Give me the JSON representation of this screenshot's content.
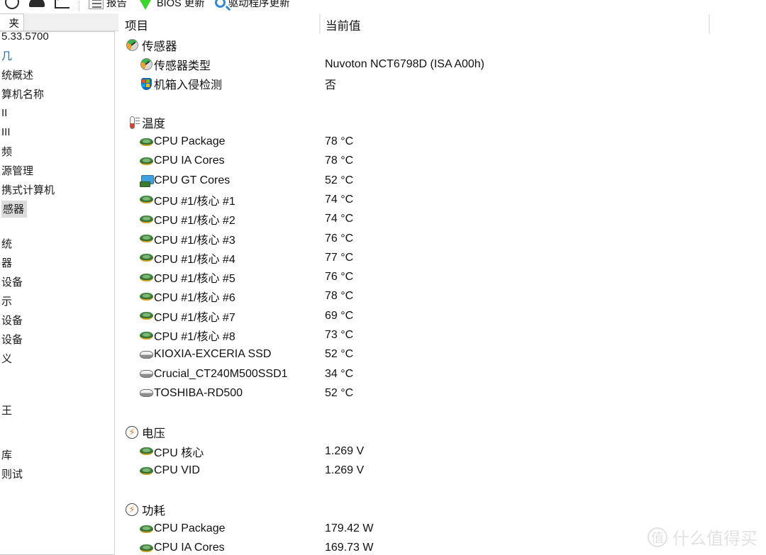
{
  "toolbar": {
    "items": [
      {
        "icon": "refresh-icon",
        "label": ""
      },
      {
        "icon": "cpu-icon",
        "label": ""
      },
      {
        "icon": "chart-icon",
        "label": ""
      },
      {
        "icon": "report-icon",
        "label": "报告"
      },
      {
        "icon": "green-arrow-icon",
        "label": "BIOS 更新"
      },
      {
        "icon": "magnifier-icon",
        "label": "驱动程序更新"
      }
    ]
  },
  "sidebar": {
    "tab_label": "夹",
    "items": [
      {
        "label": "5.33.5700",
        "state": "normal"
      },
      {
        "label": "几",
        "state": "link"
      },
      {
        "label": "统概述",
        "state": "normal"
      },
      {
        "label": "算机名称",
        "state": "normal"
      },
      {
        "label": "II",
        "state": "normal"
      },
      {
        "label": "III",
        "state": "normal"
      },
      {
        "label": "频",
        "state": "normal"
      },
      {
        "label": "源管理",
        "state": "normal"
      },
      {
        "label": "携式计算机",
        "state": "normal"
      },
      {
        "label": "感器",
        "state": "selected"
      },
      {
        "label": "统",
        "state": "normal"
      },
      {
        "label": "器",
        "state": "normal"
      },
      {
        "label": "设备",
        "state": "normal"
      },
      {
        "label": "示",
        "state": "normal"
      },
      {
        "label": "设备",
        "state": "normal"
      },
      {
        "label": "设备",
        "state": "normal"
      },
      {
        "label": "义",
        "state": "normal"
      },
      {
        "label": "王",
        "state": "normal"
      },
      {
        "label": "库",
        "state": "normal"
      },
      {
        "label": "则试",
        "state": "normal"
      }
    ]
  },
  "columns": {
    "item": "项目",
    "current_value": "当前值"
  },
  "sections": [
    {
      "title": "传感器",
      "icon": "gauge-icon",
      "rows": [
        {
          "icon": "gauge-icon",
          "label": "传感器类型",
          "value": "Nuvoton NCT6798D  (ISA A00h)"
        },
        {
          "icon": "shield-icon",
          "label": "机箱入侵检测",
          "value": "否"
        }
      ]
    },
    {
      "title": "温度",
      "icon": "thermometer-icon",
      "rows": [
        {
          "icon": "chip-icon",
          "label": "CPU Package",
          "value": "78 °C"
        },
        {
          "icon": "chip-icon",
          "label": "CPU IA Cores",
          "value": "78 °C"
        },
        {
          "icon": "gpu-icon",
          "label": "CPU GT Cores",
          "value": "52 °C"
        },
        {
          "icon": "chip-icon",
          "label": "CPU #1/核心 #1",
          "value": "74 °C"
        },
        {
          "icon": "chip-icon",
          "label": "CPU #1/核心 #2",
          "value": "74 °C"
        },
        {
          "icon": "chip-icon",
          "label": "CPU #1/核心 #3",
          "value": "76 °C"
        },
        {
          "icon": "chip-icon",
          "label": "CPU #1/核心 #4",
          "value": "77 °C"
        },
        {
          "icon": "chip-icon",
          "label": "CPU #1/核心 #5",
          "value": "76 °C"
        },
        {
          "icon": "chip-icon",
          "label": "CPU #1/核心 #6",
          "value": "78 °C"
        },
        {
          "icon": "chip-icon",
          "label": "CPU #1/核心 #7",
          "value": "69 °C"
        },
        {
          "icon": "chip-icon",
          "label": "CPU #1/核心 #8",
          "value": "73 °C"
        },
        {
          "icon": "disk-icon",
          "label": "KIOXIA-EXCERIA SSD",
          "value": "52 °C"
        },
        {
          "icon": "disk-icon",
          "label": "Crucial_CT240M500SSD1",
          "value": "34 °C"
        },
        {
          "icon": "disk-icon",
          "label": "TOSHIBA-RD500",
          "value": "52 °C"
        }
      ]
    },
    {
      "title": "电压",
      "icon": "bolt-icon",
      "rows": [
        {
          "icon": "chip-icon",
          "label": "CPU 核心",
          "value": "1.269 V"
        },
        {
          "icon": "chip-icon",
          "label": "CPU VID",
          "value": "1.269 V"
        }
      ]
    },
    {
      "title": "功耗",
      "icon": "bolt-icon",
      "rows": [
        {
          "icon": "chip-icon",
          "label": "CPU Package",
          "value": "179.42 W"
        },
        {
          "icon": "chip-icon",
          "label": "CPU IA Cores",
          "value": "169.73 W"
        }
      ]
    }
  ],
  "watermark": {
    "mark": "值",
    "text": "什么值得买"
  }
}
